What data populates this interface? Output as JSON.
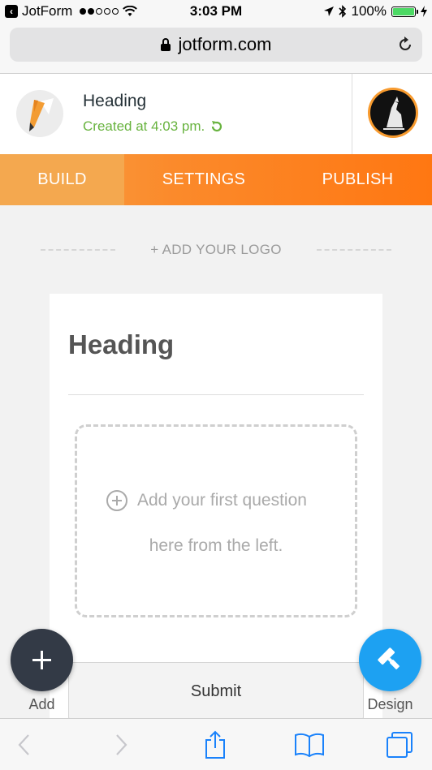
{
  "status_bar": {
    "app_back": "JotForm",
    "time": "3:03 PM",
    "battery": "100%"
  },
  "browser": {
    "url": "jotform.com"
  },
  "header": {
    "title": "Heading",
    "subtitle": "Created at 4:03 pm."
  },
  "tabs": [
    {
      "label": "BUILD"
    },
    {
      "label": "SETTINGS"
    },
    {
      "label": "PUBLISH"
    }
  ],
  "logo_row": {
    "label": "+ ADD YOUR LOGO"
  },
  "form": {
    "heading": "Heading",
    "drop_line1": "Add your first question",
    "drop_line2": "here from the left.",
    "submit_label": "Submit"
  },
  "fabs": {
    "add_label": "Add",
    "design_label": "Design"
  },
  "colors": {
    "accent_orange": "#ff7712",
    "build_tab": "#f4a84f",
    "success_green": "#68b33f",
    "design_blue": "#1da1f2",
    "add_dark": "#333a46",
    "ios_blue": "#1a82fb"
  },
  "icons": {
    "status": [
      "back-badge-icon",
      "signal-dots-icon",
      "wifi-icon",
      "location-icon",
      "bluetooth-icon",
      "battery-icon",
      "charging-icon"
    ],
    "browser": [
      "lock-icon",
      "reload-icon"
    ],
    "header": [
      "pencil-logo-icon",
      "revert-icon",
      "avatar"
    ],
    "toolbar": [
      "back-arrow-icon",
      "forward-arrow-icon",
      "share-icon",
      "bookmarks-icon",
      "tabs-icon"
    ]
  }
}
